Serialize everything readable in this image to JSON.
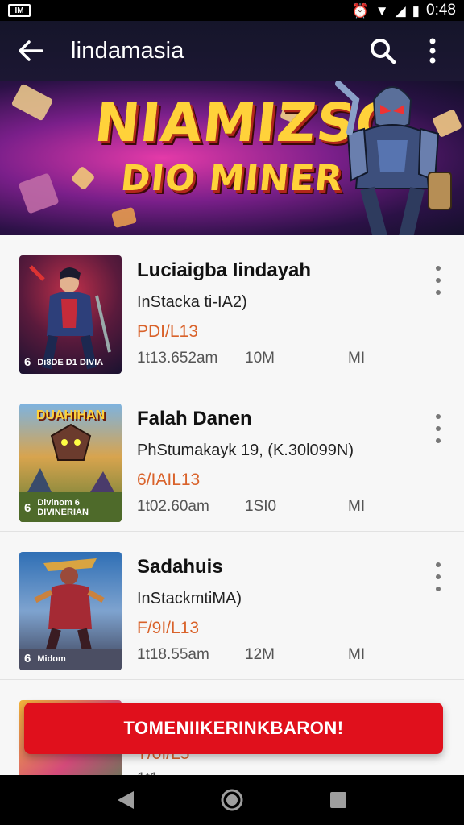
{
  "status_bar": {
    "time": "0:48",
    "left_icon": "notification-icon"
  },
  "app_bar": {
    "title": "lindamasia",
    "back_icon": "arrow-left-icon",
    "search_icon": "search-icon",
    "menu_icon": "more-vert-icon"
  },
  "banner": {
    "title_line1": "NIAMIZSO",
    "title_line2": "DIO MINER",
    "page_indicator": {
      "count": 4,
      "active": 0
    }
  },
  "items": [
    {
      "name": "Luciaigba Iindayah",
      "subtitle": "InStacka ti-IA2)",
      "price": "PDI/L13",
      "date": "1t13.652am",
      "size": "10M",
      "extra": "MI",
      "thumb_num": "6",
      "thumb_label": "Di8DE D1 DIVIA"
    },
    {
      "name": "Falah Danen",
      "subtitle": "PhStumakayk 19, (K.30l099N)",
      "price": "6/IAIL13",
      "date": "1t02.60am",
      "size": "1SI0",
      "extra": "MI",
      "thumb_num": "6",
      "thumb_label": "Divinom 6 DIVINERIAN",
      "thumb_title": "DUAHIHAN"
    },
    {
      "name": "Sadahuis",
      "subtitle": "InStackmtiMA)",
      "price": "F/9I/L13",
      "date": "1t18.55am",
      "size": "12M",
      "extra": "MI",
      "thumb_num": "6",
      "thumb_label": "Midom"
    },
    {
      "name": "",
      "subtitle": "",
      "price": "T/0I/L5",
      "date": "1t1",
      "size": "",
      "extra": "",
      "thumb_num": "",
      "thumb_label": ""
    }
  ],
  "cta_label": "TOMENIIKERINKBARON!",
  "nav": {
    "back_icon": "triangle-back-icon",
    "home_icon": "home-circle-icon",
    "recents_icon": "square-recents-icon"
  }
}
